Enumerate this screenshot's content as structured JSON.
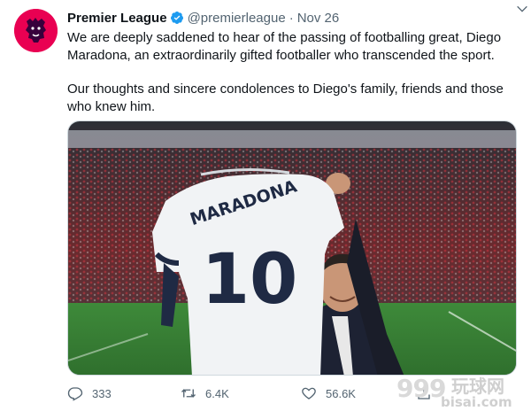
{
  "tweet": {
    "display_name": "Premier League",
    "handle": "@premierleague",
    "separator": "·",
    "date": "Nov 26",
    "paragraphs": [
      "We are deeply saddened to hear of the passing of footballing great, Diego Maradona, an extraordinarily gifted footballer who transcended the sport.",
      "Our thoughts and sincere condolences to Diego's family, friends and those who knew him."
    ],
    "shirt_name": "MARADONA",
    "shirt_number": "10"
  },
  "actions": {
    "replies": "333",
    "retweets": "6.4K",
    "likes": "56.6K"
  },
  "icons": {
    "avatar": "premier-league-lion-logo",
    "verified": "verified-badge-icon",
    "caret": "chevron-down-icon",
    "reply": "reply-icon",
    "retweet": "retweet-icon",
    "like": "heart-icon",
    "share": "share-icon"
  },
  "watermark": {
    "number": "999",
    "chinese": "玩球网",
    "domain": "bisai.com"
  },
  "colors": {
    "brand": "#e90052",
    "verified": "#1d9bf0",
    "text": "#0f1419",
    "muted": "#536471"
  }
}
